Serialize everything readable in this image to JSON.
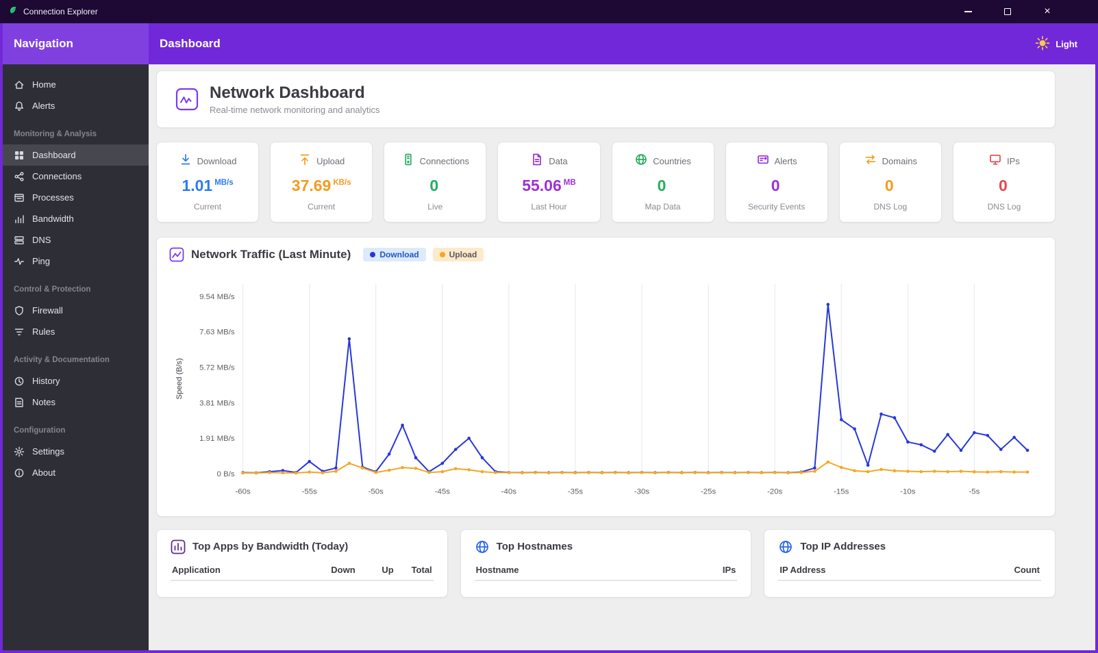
{
  "window": {
    "title": "Connection Explorer",
    "close_glyph": "×"
  },
  "header": {
    "nav_title": "Navigation",
    "page_title": "Dashboard",
    "theme_label": "Light"
  },
  "sidebar": {
    "items": [
      {
        "type": "item",
        "label": "Home"
      },
      {
        "type": "item",
        "label": "Alerts"
      },
      {
        "type": "section",
        "label": "Monitoring & Analysis"
      },
      {
        "type": "item",
        "label": "Dashboard",
        "active": true
      },
      {
        "type": "item",
        "label": "Connections"
      },
      {
        "type": "item",
        "label": "Processes"
      },
      {
        "type": "item",
        "label": "Bandwidth"
      },
      {
        "type": "item",
        "label": "DNS"
      },
      {
        "type": "item",
        "label": "Ping"
      },
      {
        "type": "section",
        "label": "Control & Protection"
      },
      {
        "type": "item",
        "label": "Firewall"
      },
      {
        "type": "item",
        "label": "Rules"
      },
      {
        "type": "section",
        "label": "Activity & Documentation"
      },
      {
        "type": "item",
        "label": "History"
      },
      {
        "type": "item",
        "label": "Notes"
      },
      {
        "type": "section",
        "label": "Configuration"
      },
      {
        "type": "item",
        "label": "Settings"
      },
      {
        "type": "item",
        "label": "About"
      }
    ]
  },
  "hero": {
    "title": "Network Dashboard",
    "subtitle": "Real-time network monitoring and analytics"
  },
  "stats": [
    {
      "label": "Download",
      "value": "1.01",
      "unit": "MB/s",
      "sub": "Current",
      "color": "#2f7af0"
    },
    {
      "label": "Upload",
      "value": "37.69",
      "unit": "KB/s",
      "sub": "Current",
      "color": "#f59b1f"
    },
    {
      "label": "Connections",
      "value": "0",
      "unit": "",
      "sub": "Live",
      "color": "#27ae60"
    },
    {
      "label": "Data",
      "value": "55.06",
      "unit": "MB",
      "sub": "Last Hour",
      "color": "#9b30d9"
    },
    {
      "label": "Countries",
      "value": "0",
      "unit": "",
      "sub": "Map Data",
      "color": "#27ae60"
    },
    {
      "label": "Alerts",
      "value": "0",
      "unit": "",
      "sub": "Security Events",
      "color": "#9b30d9"
    },
    {
      "label": "Domains",
      "value": "0",
      "unit": "",
      "sub": "DNS Log",
      "color": "#f59b1f"
    },
    {
      "label": "IPs",
      "value": "0",
      "unit": "",
      "sub": "DNS Log",
      "color": "#e5484d"
    }
  ],
  "chart_data": {
    "type": "line",
    "title": "Network Traffic (Last Minute)",
    "ylabel": "Speed (B/s)",
    "xlabel": "",
    "grid": "vertical",
    "legend_position": "top",
    "ylim_mbps": [
      0,
      10.2
    ],
    "x": [
      -60,
      -59,
      -58,
      -57,
      -56,
      -55,
      -54,
      -53,
      -52,
      -51,
      -50,
      -49,
      -48,
      -47,
      -46,
      -45,
      -44,
      -43,
      -42,
      -41,
      -40,
      -39,
      -38,
      -37,
      -36,
      -35,
      -34,
      -33,
      -32,
      -31,
      -30,
      -29,
      -28,
      -27,
      -26,
      -25,
      -24,
      -23,
      -22,
      -21,
      -20,
      -19,
      -18,
      -17,
      -16,
      -15,
      -14,
      -13,
      -12,
      -11,
      -10,
      -9,
      -8,
      -7,
      -6,
      -5,
      -4,
      -3,
      -2,
      -1
    ],
    "x_ticks": [
      -60,
      -55,
      -50,
      -45,
      -40,
      -35,
      -30,
      -25,
      -20,
      -15,
      -10,
      -5
    ],
    "x_tick_labels": [
      "-60s",
      "-55s",
      "-50s",
      "-45s",
      "-40s",
      "-35s",
      "-30s",
      "-25s",
      "-20s",
      "-15s",
      "-10s",
      "-5s"
    ],
    "y_ticks_mbps": [
      0,
      1.91,
      3.81,
      5.72,
      7.63,
      9.54
    ],
    "y_tick_labels": [
      "0 B/s",
      "1.91 MB/s",
      "3.81 MB/s",
      "5.72 MB/s",
      "7.63 MB/s",
      "9.54 MB/s"
    ],
    "legend": [
      {
        "name": "Download",
        "color": "#2636d9"
      },
      {
        "name": "Upload",
        "color": "#f5a623"
      }
    ],
    "series": [
      {
        "name": "Download",
        "color": "#2636d9",
        "values_mbps": [
          0.05,
          0.04,
          0.1,
          0.16,
          0.06,
          0.65,
          0.12,
          0.3,
          7.25,
          0.35,
          0.1,
          1.05,
          2.6,
          0.85,
          0.1,
          0.55,
          1.3,
          1.9,
          0.85,
          0.1,
          0.06,
          0.05,
          0.06,
          0.05,
          0.06,
          0.05,
          0.06,
          0.05,
          0.06,
          0.05,
          0.06,
          0.05,
          0.06,
          0.05,
          0.06,
          0.05,
          0.06,
          0.05,
          0.06,
          0.05,
          0.06,
          0.05,
          0.08,
          0.3,
          9.1,
          2.9,
          2.4,
          0.45,
          3.2,
          3.0,
          1.7,
          1.55,
          1.2,
          2.1,
          1.25,
          2.2,
          2.05,
          1.3,
          1.95,
          1.25
        ]
      },
      {
        "name": "Upload",
        "color": "#f5a623",
        "values_mbps": [
          0.03,
          0.03,
          0.05,
          0.04,
          0.03,
          0.08,
          0.04,
          0.12,
          0.55,
          0.3,
          0.06,
          0.18,
          0.32,
          0.28,
          0.06,
          0.1,
          0.26,
          0.2,
          0.1,
          0.05,
          0.05,
          0.04,
          0.05,
          0.04,
          0.05,
          0.04,
          0.05,
          0.04,
          0.05,
          0.04,
          0.05,
          0.04,
          0.05,
          0.04,
          0.05,
          0.04,
          0.05,
          0.04,
          0.05,
          0.04,
          0.05,
          0.04,
          0.06,
          0.12,
          0.62,
          0.33,
          0.15,
          0.1,
          0.22,
          0.15,
          0.12,
          0.1,
          0.12,
          0.1,
          0.12,
          0.09,
          0.08,
          0.1,
          0.08,
          0.08
        ]
      }
    ]
  },
  "tables": [
    {
      "title": "Top Apps by Bandwidth (Today)",
      "columns": [
        "Application",
        "Down",
        "Up",
        "Total"
      ],
      "rows": []
    },
    {
      "title": "Top Hostnames",
      "columns": [
        "Hostname",
        "IPs"
      ],
      "rows": []
    },
    {
      "title": "Top IP Addresses",
      "columns": [
        "IP Address",
        "Count"
      ],
      "rows": []
    }
  ]
}
